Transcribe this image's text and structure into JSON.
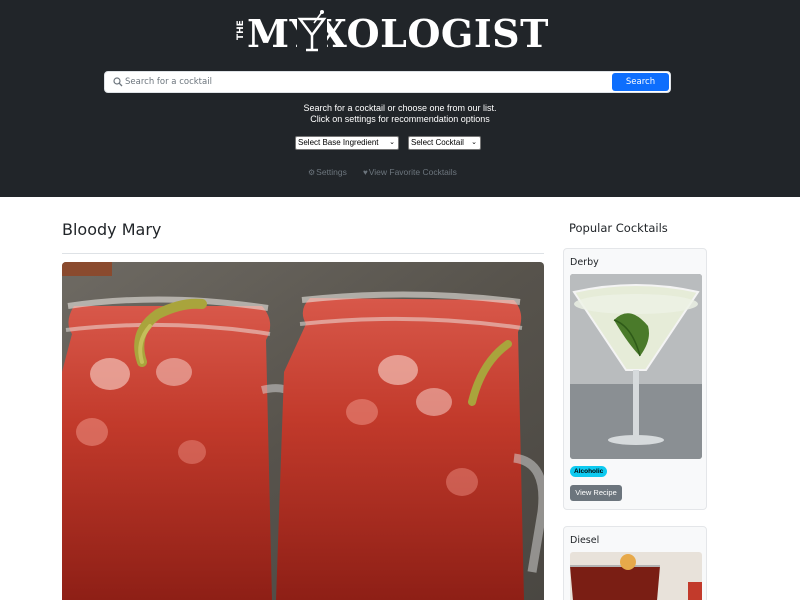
{
  "header": {
    "logo_prefix": "THE",
    "logo_text": "MYXOLOGIST",
    "search_placeholder": "Search for a cocktail",
    "search_button": "Search",
    "helper_line1": "Search for a cocktail or choose one from our list.",
    "helper_line2": "Click on settings for recommendation options",
    "select_base": "Select Base Ingredient",
    "select_cocktail": "Select Cocktail",
    "settings_link": "Settings",
    "favorites_link": "View Favorite Cocktails",
    "colors": {
      "background": "#212529",
      "primary": "#0d6efd"
    }
  },
  "main": {
    "title": "Bloody Mary"
  },
  "sidebar": {
    "heading": "Popular Cocktails",
    "cards": [
      {
        "name": "Derby",
        "badge": "Alcoholic",
        "button": "View Recipe"
      },
      {
        "name": "Diesel"
      }
    ],
    "colors": {
      "badge": "#0dcaf0",
      "button": "#6c757d"
    }
  }
}
